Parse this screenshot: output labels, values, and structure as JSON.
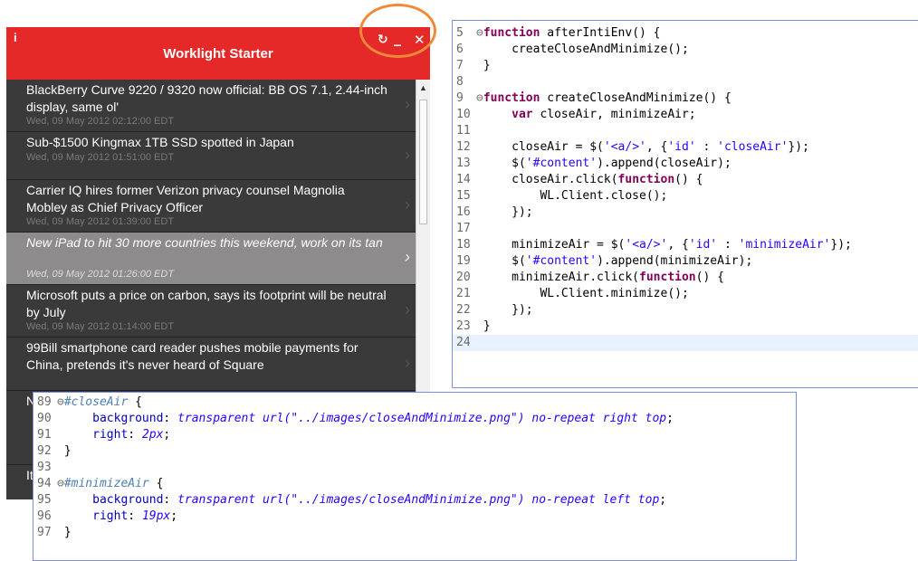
{
  "app": {
    "info_icon": "i",
    "title": "Worklight Starter",
    "refresh_icon": "refresh-icon",
    "minimize_icon": "minimize-icon",
    "close_icon": "close-icon",
    "header_color": "#e52929",
    "highlight_color": "#f08a3a"
  },
  "feed": {
    "items": [
      {
        "title": "BlackBerry Curve 9220 / 9320 now official: BB OS 7.1, 2.44-inch display, same ol'",
        "date": "Wed, 09 May 2012 02:12:00 EDT",
        "selected": false
      },
      {
        "title": "Sub-$1500 Kingmax 1TB SSD spotted in Japan",
        "date": "Wed, 09 May 2012 01:51:00 EDT",
        "selected": false
      },
      {
        "title": "Carrier IQ hires former Verizon privacy counsel Magnolia Mobley as Chief Privacy Officer",
        "date": "Wed, 09 May 2012 01:39:00 EDT",
        "selected": false
      },
      {
        "title": "New iPad to hit 30 more countries this weekend, work on its tan",
        "date": "Wed, 09 May 2012 01:26:00 EDT",
        "selected": true
      },
      {
        "title": "Microsoft puts a price on carbon, says its footprint will be neutral by July",
        "date": "Wed, 09 May 2012 01:14:00 EDT",
        "selected": false
      },
      {
        "title": "99Bill smartphone card reader pushes mobile payments for China, pretends it's never heard of Square",
        "date": "",
        "selected": false
      },
      {
        "title": "N",
        "date": "",
        "selected": false
      },
      {
        "title": "It",
        "date": "",
        "selected": false
      }
    ]
  },
  "js_code": {
    "lines": [
      {
        "n": "5",
        "fold": "⊖",
        "html": "<span class=\"kw\">function</span> afterIntiEnv() {"
      },
      {
        "n": "6",
        "fold": "",
        "html": "    createCloseAndMinimize();"
      },
      {
        "n": "7",
        "fold": "",
        "html": "}"
      },
      {
        "n": "8",
        "fold": "",
        "html": ""
      },
      {
        "n": "9",
        "fold": "⊖",
        "html": "<span class=\"kw\">function</span> createCloseAndMinimize() {"
      },
      {
        "n": "10",
        "fold": "",
        "html": "    <span class=\"kw\">var</span> closeAir, minimizeAir;"
      },
      {
        "n": "11",
        "fold": "",
        "html": ""
      },
      {
        "n": "12",
        "fold": "",
        "html": "    closeAir = $(<span class=\"str\">'&lt;a/&gt;'</span>, {<span class=\"str\">'id'</span> : <span class=\"str\">'closeAir'</span>});"
      },
      {
        "n": "13",
        "fold": "",
        "html": "    $(<span class=\"str\">'#content'</span>).append(closeAir);"
      },
      {
        "n": "14",
        "fold": "",
        "html": "    closeAir.click(<span class=\"kw\">function</span>() {"
      },
      {
        "n": "15",
        "fold": "",
        "html": "        WL.Client.close();"
      },
      {
        "n": "16",
        "fold": "",
        "html": "    });"
      },
      {
        "n": "17",
        "fold": "",
        "html": ""
      },
      {
        "n": "18",
        "fold": "",
        "html": "    minimizeAir = $(<span class=\"str\">'&lt;a/&gt;'</span>, {<span class=\"str\">'id'</span> : <span class=\"str\">'minimizeAir'</span>});"
      },
      {
        "n": "19",
        "fold": "",
        "html": "    $(<span class=\"str\">'#content'</span>).append(minimizeAir);"
      },
      {
        "n": "20",
        "fold": "",
        "html": "    minimizeAir.click(<span class=\"kw\">function</span>() {"
      },
      {
        "n": "21",
        "fold": "",
        "html": "        WL.Client.minimize();"
      },
      {
        "n": "22",
        "fold": "",
        "html": "    });"
      },
      {
        "n": "23",
        "fold": "",
        "html": "}"
      },
      {
        "n": "24",
        "fold": "",
        "html": "",
        "highlight": true
      }
    ]
  },
  "css_code": {
    "lines": [
      {
        "n": "89",
        "fold": "⊖",
        "html": "<span class=\"sel\">#closeAir</span> {"
      },
      {
        "n": "90",
        "fold": "",
        "html": "    <span class=\"prop\">background</span>: <span class=\"val\">transparent url(\"../images/closeAndMinimize.png\") no-repeat right top</span>;"
      },
      {
        "n": "91",
        "fold": "",
        "html": "    <span class=\"prop\">right</span>: <span class=\"val\">2px</span>;"
      },
      {
        "n": "92",
        "fold": "",
        "html": "}"
      },
      {
        "n": "93",
        "fold": "",
        "html": ""
      },
      {
        "n": "94",
        "fold": "⊖",
        "html": "<span class=\"sel\">#minimizeAir</span> {"
      },
      {
        "n": "95",
        "fold": "",
        "html": "    <span class=\"prop\">background</span>: <span class=\"val\">transparent url(\"../images/closeAndMinimize.png\") no-repeat left top</span>;"
      },
      {
        "n": "96",
        "fold": "",
        "html": "    <span class=\"prop\">right</span>: <span class=\"val\">19px</span>;"
      },
      {
        "n": "97",
        "fold": "",
        "html": "}"
      }
    ]
  }
}
